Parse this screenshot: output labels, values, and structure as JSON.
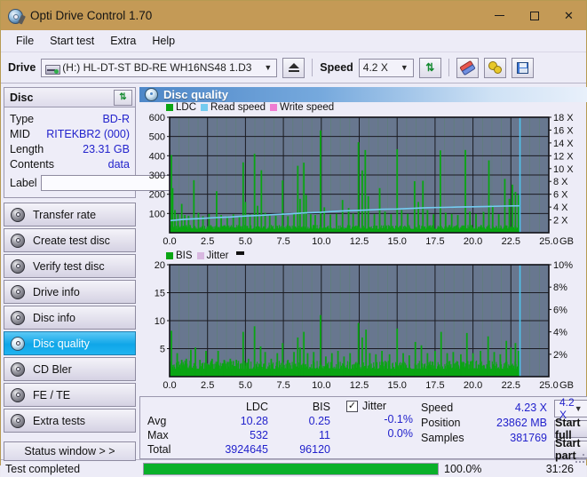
{
  "window": {
    "title": "Opti Drive Control 1.70",
    "app_icon": "disc-pen-icon",
    "minimize": "minimize",
    "maximize": "maximize",
    "close": "close",
    "titlebar_color": "#c49a56"
  },
  "menu": {
    "items": [
      "File",
      "Start test",
      "Extra",
      "Help"
    ]
  },
  "toolbar": {
    "drive_label": "Drive",
    "drive_value": "(H:)  HL-DT-ST BD-RE  WH16NS48 1.D3",
    "eject_title": "eject",
    "speed_label": "Speed",
    "speed_value": "4.2 X",
    "refresh_title": "refresh",
    "erase_title": "erase",
    "settings_title": "settings",
    "save_title": "save"
  },
  "disc": {
    "panel_title": "Disc",
    "refresh_glyph": "⇅",
    "rows": [
      {
        "key": "Type",
        "value": "BD-R"
      },
      {
        "key": "MID",
        "value": "RITEKBR2 (000)"
      },
      {
        "key": "Length",
        "value": "23.31 GB"
      },
      {
        "key": "Contents",
        "value": "data"
      }
    ],
    "label_key": "Label",
    "label_value": "",
    "label_placeholder": ""
  },
  "nav": {
    "items": [
      {
        "label": "Transfer rate",
        "active": false
      },
      {
        "label": "Create test disc",
        "active": false
      },
      {
        "label": "Verify test disc",
        "active": false
      },
      {
        "label": "Drive info",
        "active": false
      },
      {
        "label": "Disc info",
        "active": false
      },
      {
        "label": "Disc quality",
        "active": true
      },
      {
        "label": "CD Bler",
        "active": false
      },
      {
        "label": "FE / TE",
        "active": false
      },
      {
        "label": "Extra tests",
        "active": false
      }
    ],
    "status_window": "Status window > >"
  },
  "main": {
    "header_title": "Disc quality",
    "header_icon": "disc-quality-icon"
  },
  "chart_data": [
    {
      "type": "line",
      "name": "ldc-chart",
      "title": "",
      "xlabel": "GB",
      "ylabel": "",
      "xlim": [
        0,
        25
      ],
      "ylim": [
        0,
        600
      ],
      "y2lim": [
        0,
        18
      ],
      "xticks": [
        "0.0",
        "2.5",
        "5.0",
        "7.5",
        "10.0",
        "12.5",
        "15.0",
        "17.5",
        "20.0",
        "22.5",
        "25.0"
      ],
      "yticks": [
        "100",
        "200",
        "300",
        "400",
        "500",
        "600"
      ],
      "y2ticks": [
        "2 X",
        "4 X",
        "6 X",
        "8 X",
        "10 X",
        "12 X",
        "14 X",
        "16 X",
        "18 X"
      ],
      "x_unit": "GB",
      "grid": true,
      "legend_position": "top-left",
      "legend": [
        {
          "name": "LDC",
          "color": "#0aa513"
        },
        {
          "name": "Read speed",
          "color": "#74cbf0"
        },
        {
          "name": "Write speed",
          "color": "#ef7cd2"
        }
      ],
      "series": [
        {
          "name": "LDC",
          "color": "#0aa513",
          "type": "impulse",
          "baseline": 20,
          "spikes": [
            [
              0.12,
              404
            ],
            [
              0.2,
              232
            ],
            [
              0.35,
              118
            ],
            [
              0.55,
              96
            ],
            [
              0.8,
              150
            ],
            [
              1.0,
              92
            ],
            [
              1.25,
              88
            ],
            [
              1.6,
              273
            ],
            [
              1.9,
              104
            ],
            [
              2.2,
              86
            ],
            [
              2.6,
              98
            ],
            [
              3.1,
              216
            ],
            [
              3.4,
              92
            ],
            [
              3.8,
              86
            ],
            [
              4.2,
              96
            ],
            [
              4.6,
              84
            ],
            [
              4.85,
              366
            ],
            [
              5.0,
              160
            ],
            [
              5.3,
              96
            ],
            [
              5.6,
              410
            ],
            [
              5.8,
              140
            ],
            [
              6.05,
              325
            ],
            [
              6.3,
              104
            ],
            [
              6.6,
              96
            ],
            [
              7.0,
              88
            ],
            [
              7.45,
              272
            ],
            [
              7.8,
              86
            ],
            [
              8.2,
              98
            ],
            [
              8.45,
              348
            ],
            [
              8.6,
              176
            ],
            [
              8.85,
              364
            ],
            [
              9.0,
              196
            ],
            [
              9.3,
              96
            ],
            [
              9.6,
              92
            ],
            [
              9.95,
              532
            ],
            [
              10.2,
              132
            ],
            [
              10.6,
              94
            ],
            [
              11.0,
              98
            ],
            [
              11.4,
              170
            ],
            [
              11.8,
              128
            ],
            [
              12.1,
              100
            ],
            [
              12.45,
              470
            ],
            [
              12.7,
              324
            ],
            [
              12.9,
              430
            ],
            [
              13.1,
              190
            ],
            [
              13.5,
              96
            ],
            [
              13.85,
              232
            ],
            [
              14.2,
              110
            ],
            [
              14.6,
              96
            ],
            [
              15.0,
              434
            ],
            [
              15.3,
              118
            ],
            [
              15.7,
              98
            ],
            [
              16.15,
              268
            ],
            [
              16.4,
              160
            ],
            [
              16.7,
              270
            ],
            [
              17.0,
              118
            ],
            [
              17.4,
              96
            ],
            [
              17.85,
              428
            ],
            [
              18.2,
              104
            ],
            [
              18.6,
              98
            ],
            [
              19.0,
              92
            ],
            [
              19.5,
              430
            ],
            [
              19.8,
              110
            ],
            [
              20.2,
              98
            ],
            [
              20.7,
              108
            ],
            [
              21.05,
              376
            ],
            [
              21.3,
              142
            ],
            [
              21.7,
              96
            ],
            [
              22.1,
              280
            ],
            [
              22.4,
              176
            ],
            [
              22.6,
              250
            ],
            [
              22.8,
              212
            ],
            [
              23.0,
              196
            ]
          ]
        },
        {
          "name": "Read speed",
          "color": "#74cbf0",
          "type": "line",
          "axis": "right",
          "points": [
            [
              0.05,
              1.9
            ],
            [
              1.0,
              2.1
            ],
            [
              2.0,
              2.2
            ],
            [
              3.0,
              2.35
            ],
            [
              4.0,
              2.45
            ],
            [
              5.0,
              2.6
            ],
            [
              6.0,
              2.7
            ],
            [
              7.0,
              2.85
            ],
            [
              8.0,
              2.95
            ],
            [
              9.0,
              3.1
            ],
            [
              10.0,
              3.2
            ],
            [
              11.0,
              3.35
            ],
            [
              12.0,
              3.45
            ],
            [
              13.0,
              3.55
            ],
            [
              14.0,
              3.65
            ],
            [
              15.0,
              3.7
            ],
            [
              16.0,
              3.8
            ],
            [
              17.0,
              3.9
            ],
            [
              18.0,
              3.95
            ],
            [
              19.0,
              4.0
            ],
            [
              20.0,
              4.05
            ],
            [
              21.0,
              4.1
            ],
            [
              22.0,
              4.15
            ],
            [
              23.05,
              4.2
            ]
          ]
        },
        {
          "name": "Write speed",
          "color": "#ef7cd2",
          "type": "line",
          "points": []
        }
      ],
      "end_marker_x": 23.1,
      "end_marker_color": "#4fc3ef"
    },
    {
      "type": "line",
      "name": "bis-chart",
      "title": "",
      "xlabel": "GB",
      "ylabel": "",
      "xlim": [
        0,
        25
      ],
      "ylim": [
        0,
        20
      ],
      "y2lim": [
        0,
        10
      ],
      "xticks": [
        "0.0",
        "2.5",
        "5.0",
        "7.5",
        "10.0",
        "12.5",
        "15.0",
        "17.5",
        "20.0",
        "22.5",
        "25.0"
      ],
      "yticks": [
        "5",
        "10",
        "15",
        "20"
      ],
      "y2ticks": [
        "2%",
        "4%",
        "6%",
        "8%",
        "10%"
      ],
      "x_unit": "GB",
      "grid": true,
      "legend_position": "top-left",
      "legend": [
        {
          "name": "BIS",
          "color": "#0aa513"
        },
        {
          "name": "Jitter",
          "color": "#d8b8e0"
        }
      ],
      "series": [
        {
          "name": "BIS",
          "color": "#0aa513",
          "type": "impulse",
          "baseline": 1.4,
          "spikes": [
            [
              0.12,
              8.2
            ],
            [
              0.5,
              4.2
            ],
            [
              0.8,
              3.0
            ],
            [
              1.1,
              3.2
            ],
            [
              1.4,
              4.8
            ],
            [
              1.7,
              5.2
            ],
            [
              2.0,
              3.0
            ],
            [
              2.4,
              4.6
            ],
            [
              2.8,
              3.2
            ],
            [
              3.2,
              4.6
            ],
            [
              3.6,
              3.0
            ],
            [
              4.0,
              3.2
            ],
            [
              4.4,
              3.0
            ],
            [
              4.85,
              8.0
            ],
            [
              5.2,
              3.2
            ],
            [
              5.6,
              9.0
            ],
            [
              6.0,
              5.4
            ],
            [
              6.3,
              4.4
            ],
            [
              6.7,
              3.2
            ],
            [
              7.1,
              4.2
            ],
            [
              7.45,
              6.0
            ],
            [
              7.8,
              3.0
            ],
            [
              8.2,
              4.4
            ],
            [
              8.45,
              7.0
            ],
            [
              8.6,
              5.2
            ],
            [
              8.85,
              8.0
            ],
            [
              9.1,
              4.2
            ],
            [
              9.5,
              4.4
            ],
            [
              9.95,
              11.0
            ],
            [
              10.3,
              3.6
            ],
            [
              10.7,
              4.2
            ],
            [
              11.1,
              4.6
            ],
            [
              11.5,
              3.6
            ],
            [
              11.9,
              4.2
            ],
            [
              12.45,
              9.6
            ],
            [
              12.7,
              7.0
            ],
            [
              12.95,
              8.4
            ],
            [
              13.2,
              4.2
            ],
            [
              13.6,
              4.0
            ],
            [
              14.0,
              4.6
            ],
            [
              14.5,
              4.0
            ],
            [
              15.0,
              8.6
            ],
            [
              15.4,
              4.2
            ],
            [
              15.8,
              3.8
            ],
            [
              16.2,
              6.2
            ],
            [
              16.6,
              5.6
            ],
            [
              17.0,
              4.2
            ],
            [
              17.5,
              4.6
            ],
            [
              17.9,
              8.0
            ],
            [
              18.3,
              4.2
            ],
            [
              18.7,
              4.4
            ],
            [
              19.2,
              4.0
            ],
            [
              19.6,
              7.8
            ],
            [
              20.0,
              4.2
            ],
            [
              20.5,
              4.6
            ],
            [
              21.0,
              7.2
            ],
            [
              21.4,
              4.4
            ],
            [
              21.8,
              4.0
            ],
            [
              22.2,
              6.4
            ],
            [
              22.5,
              5.2
            ],
            [
              22.8,
              6.0
            ],
            [
              23.0,
              4.6
            ]
          ]
        },
        {
          "name": "Jitter",
          "color": "#d8b8e0",
          "type": "line",
          "points": []
        }
      ],
      "end_marker_x": 23.1,
      "end_marker_color": "#4fc3ef"
    }
  ],
  "stats": {
    "col_headers": [
      "",
      "LDC",
      "BIS"
    ],
    "rows": [
      {
        "label": "Avg",
        "ldc": "10.28",
        "bis": "0.25"
      },
      {
        "label": "Max",
        "ldc": "532",
        "bis": "11"
      },
      {
        "label": "Total",
        "ldc": "3924645",
        "bis": "96120"
      }
    ],
    "jitter": {
      "label": "Jitter",
      "checked": true,
      "check_glyph": "✓",
      "values": [
        "-0.1%",
        "0.0%"
      ]
    },
    "speed": {
      "key": "Speed",
      "value": "4.23 X"
    },
    "position": {
      "key": "Position",
      "value": "23862 MB"
    },
    "samples": {
      "key": "Samples",
      "value": "381769"
    },
    "speed_select": "4.2 X",
    "start_full": "Start full",
    "start_part": "Start part"
  },
  "statusbar": {
    "message": "Test completed",
    "progress_percent": 100.0,
    "progress_text": "100.0%",
    "elapsed": "31:26",
    "progress_color": "#0ab02a"
  }
}
